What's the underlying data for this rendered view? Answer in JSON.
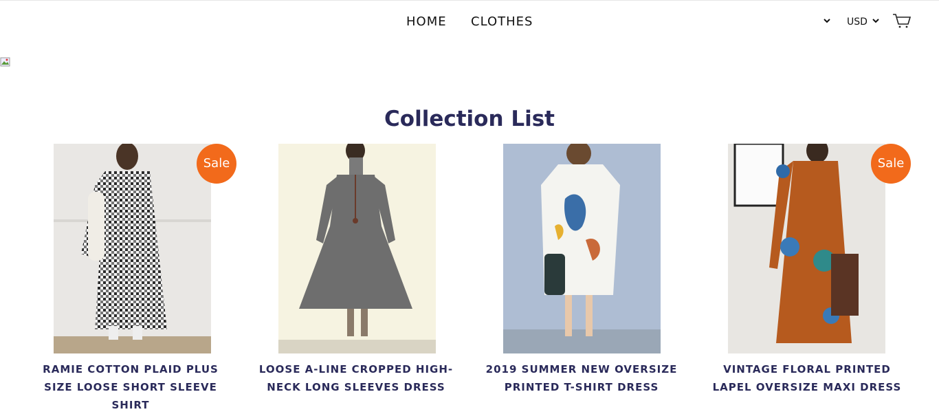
{
  "nav": {
    "home": "HOME",
    "clothes": "CLOTHES"
  },
  "tools": {
    "currency": "USD",
    "cart_icon": "cart-icon",
    "chevron_icon": "chevron-down-icon"
  },
  "hero": {
    "broken_image_icon": "broken-image-icon"
  },
  "section": {
    "title": "Collection List"
  },
  "products": [
    {
      "name": "RAMIE COTTON PLAID PLUS SIZE LOOSE SHORT SLEEVE SHIRT",
      "sale": "Sale"
    },
    {
      "name": "LOOSE A-LINE CROPPED HIGH-NECK LONG SLEEVES DRESS",
      "sale": ""
    },
    {
      "name": "2019 SUMMER NEW OVERSIZE PRINTED T-SHIRT DRESS",
      "sale": ""
    },
    {
      "name": "VINTAGE FLORAL PRINTED LAPEL OVERSIZE MAXI DRESS",
      "sale": "Sale"
    }
  ],
  "colors": {
    "title": "#2a2a5a",
    "sale_badge": "#f26a1b"
  }
}
